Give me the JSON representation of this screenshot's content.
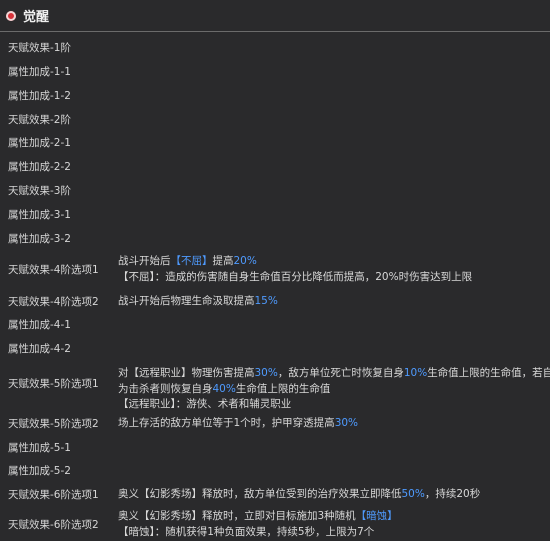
{
  "header": {
    "title": "觉醒"
  },
  "rows": [
    {
      "label": "天赋效果-1阶"
    },
    {
      "label": "属性加成-1-1"
    },
    {
      "label": "属性加成-1-2"
    },
    {
      "label": "天赋效果-2阶"
    },
    {
      "label": "属性加成-2-1"
    },
    {
      "label": "属性加成-2-2"
    },
    {
      "label": "天赋效果-3阶"
    },
    {
      "label": "属性加成-3-1"
    },
    {
      "label": "属性加成-3-2"
    },
    {
      "label": "天赋效果-4阶选项1",
      "desc": [
        [
          {
            "t": "战斗开始后"
          },
          {
            "t": "【不屈】",
            "hl": true
          },
          {
            "t": "提高"
          },
          {
            "t": "20%",
            "hl": true
          }
        ],
        [
          {
            "t": "【不屈】：造成的伤害随自身生命值百分比降低而提高，20%时伤害达到上限"
          }
        ]
      ]
    },
    {
      "label": "天赋效果-4阶选项2",
      "desc": [
        [
          {
            "t": "战斗开始后物理生命汲取提高"
          },
          {
            "t": "15%",
            "hl": true
          }
        ]
      ]
    },
    {
      "label": "属性加成-4-1"
    },
    {
      "label": "属性加成-4-2"
    },
    {
      "label": "天赋效果-5阶选项1",
      "desc": [
        [
          {
            "t": "对【远程职业】物理伤害提高"
          },
          {
            "t": "30%",
            "hl": true
          },
          {
            "t": "，敌方单位死亡时恢复自身"
          },
          {
            "t": "10%",
            "hl": true
          },
          {
            "t": "生命值上限的生命值，若自身"
          }
        ],
        [
          {
            "t": "为击杀者则恢复自身"
          },
          {
            "t": "40%",
            "hl": true
          },
          {
            "t": "生命值上限的生命值"
          }
        ],
        [
          {
            "t": "【远程职业】：游侠、术者和辅灵职业"
          }
        ]
      ]
    },
    {
      "label": "天赋效果-5阶选项2",
      "desc": [
        [
          {
            "t": "场上存活的敌方单位等于1个时，护甲穿透提高"
          },
          {
            "t": "30%",
            "hl": true
          }
        ]
      ]
    },
    {
      "label": "属性加成-5-1"
    },
    {
      "label": "属性加成-5-2"
    },
    {
      "label": "天赋效果-6阶选项1",
      "desc": [
        [
          {
            "t": "奥义【幻影秀场】释放时，敌方单位受到的治疗效果立即降低"
          },
          {
            "t": "50%",
            "hl": true
          },
          {
            "t": "，持续20秒"
          }
        ]
      ]
    },
    {
      "label": "天赋效果-6阶选项2",
      "desc": [
        [
          {
            "t": "奥义【幻影秀场】释放时，立即对目标施加3种随机"
          },
          {
            "t": "【暗蚀】",
            "hl": true
          }
        ],
        [
          {
            "t": "【暗蚀】：随机获得1种负面效果，持续5秒，上限为7个"
          }
        ]
      ]
    }
  ]
}
